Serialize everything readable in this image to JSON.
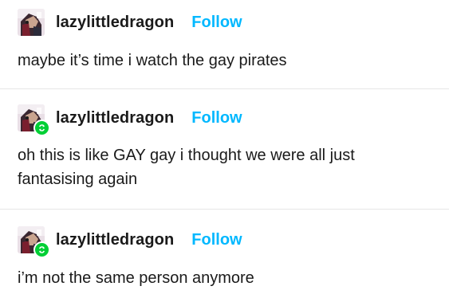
{
  "posts": [
    {
      "username": "lazylittledragon",
      "follow_label": "Follow",
      "text": "maybe it’s time i watch the gay pirates",
      "reblog": false
    },
    {
      "username": "lazylittledragon",
      "follow_label": "Follow",
      "text": "oh this is like GAY gay i thought we were all just fantasising again",
      "reblog": true
    },
    {
      "username": "lazylittledragon",
      "follow_label": "Follow",
      "text": "i’m not the same person anymore",
      "reblog": true
    }
  ],
  "colors": {
    "follow": "#00b8ff",
    "reblog_badge": "#00cf35",
    "divider": "#e6e6e6"
  },
  "icons": {
    "avatar": "avatar-image",
    "reblog": "reblog-icon"
  }
}
